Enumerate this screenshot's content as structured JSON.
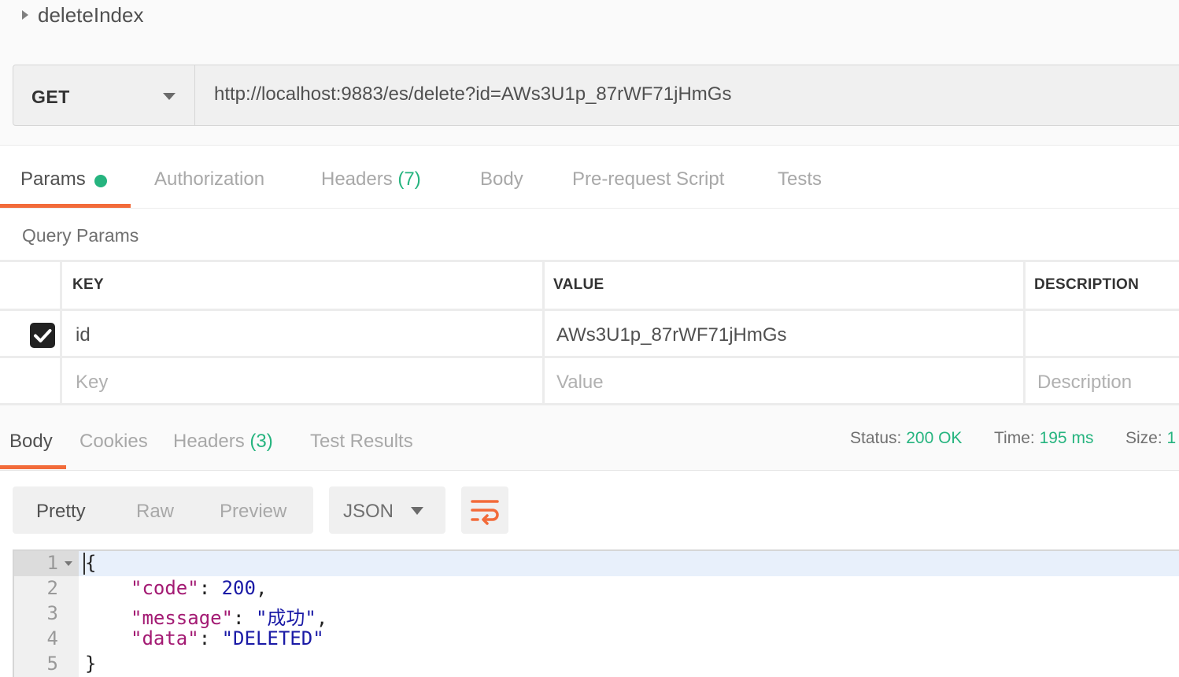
{
  "request": {
    "name": "deleteIndex",
    "method": "GET",
    "url": "http://localhost:9883/es/delete?id=AWs3U1p_87rWF71jHmGs"
  },
  "request_tabs": {
    "params": "Params",
    "authorization": "Authorization",
    "headers": "Headers",
    "headers_count": "(7)",
    "body": "Body",
    "prerequest": "Pre-request Script",
    "tests": "Tests"
  },
  "query_params": {
    "title": "Query Params",
    "columns": {
      "key": "KEY",
      "value": "VALUE",
      "description": "DESCRIPTION"
    },
    "rows": [
      {
        "checked": true,
        "key": "id",
        "value": "AWs3U1p_87rWF71jHmGs",
        "description": ""
      }
    ],
    "placeholders": {
      "key": "Key",
      "value": "Value",
      "description": "Description"
    }
  },
  "response_tabs": {
    "body": "Body",
    "cookies": "Cookies",
    "headers": "Headers",
    "headers_count": "(3)",
    "test_results": "Test Results"
  },
  "response_meta": {
    "status_label": "Status:",
    "status_value": "200 OK",
    "time_label": "Time:",
    "time_value": "195 ms",
    "size_label": "Size:",
    "size_value": "1"
  },
  "view": {
    "pretty": "Pretty",
    "raw": "Raw",
    "preview": "Preview",
    "format": "JSON"
  },
  "code": {
    "line_numbers": [
      "1",
      "2",
      "3",
      "4",
      "5"
    ],
    "open_brace": "{",
    "code_key": "\"code\"",
    "code_value": "200",
    "message_key": "\"message\"",
    "message_value": "\"成功\"",
    "data_key": "\"data\"",
    "data_value": "\"DELETED\"",
    "close_brace": "}"
  },
  "colors": {
    "accent": "#f26b3a",
    "success": "#26b47f",
    "json_key": "#a31a73",
    "json_value": "#1a1aa6"
  }
}
